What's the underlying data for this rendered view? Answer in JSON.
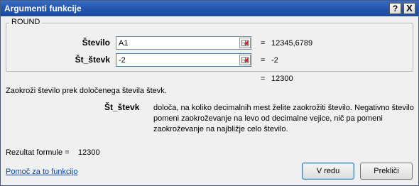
{
  "window": {
    "title": "Argumenti funkcije",
    "help_button": "?",
    "close_button": "X"
  },
  "function_group": {
    "name": "ROUND",
    "arguments": [
      {
        "label": "Število",
        "input_value": "A1",
        "result": "12345,6789"
      },
      {
        "label": "Št_števk",
        "input_value": "-2",
        "result": "-2"
      }
    ],
    "equals": "=",
    "function_result": "12300"
  },
  "description": "Zaokroži število prek določenega števila števk.",
  "argument_help": {
    "name": "Št_števk",
    "text": "določa, na koliko decimalnih mest želite zaokrožiti število. Negativno število pomeni zaokroževanje na levo od decimalne vejice, nič pa pomeni zaokroževanje na najbližje celo število."
  },
  "formula_result": {
    "label": "Rezultat formule =",
    "value": "12300"
  },
  "help_link": "Pomoč za to funkcijo",
  "buttons": {
    "ok": "V redu",
    "cancel": "Prekliči"
  },
  "icons": {
    "range_selector": "collapse-dialog-icon"
  }
}
